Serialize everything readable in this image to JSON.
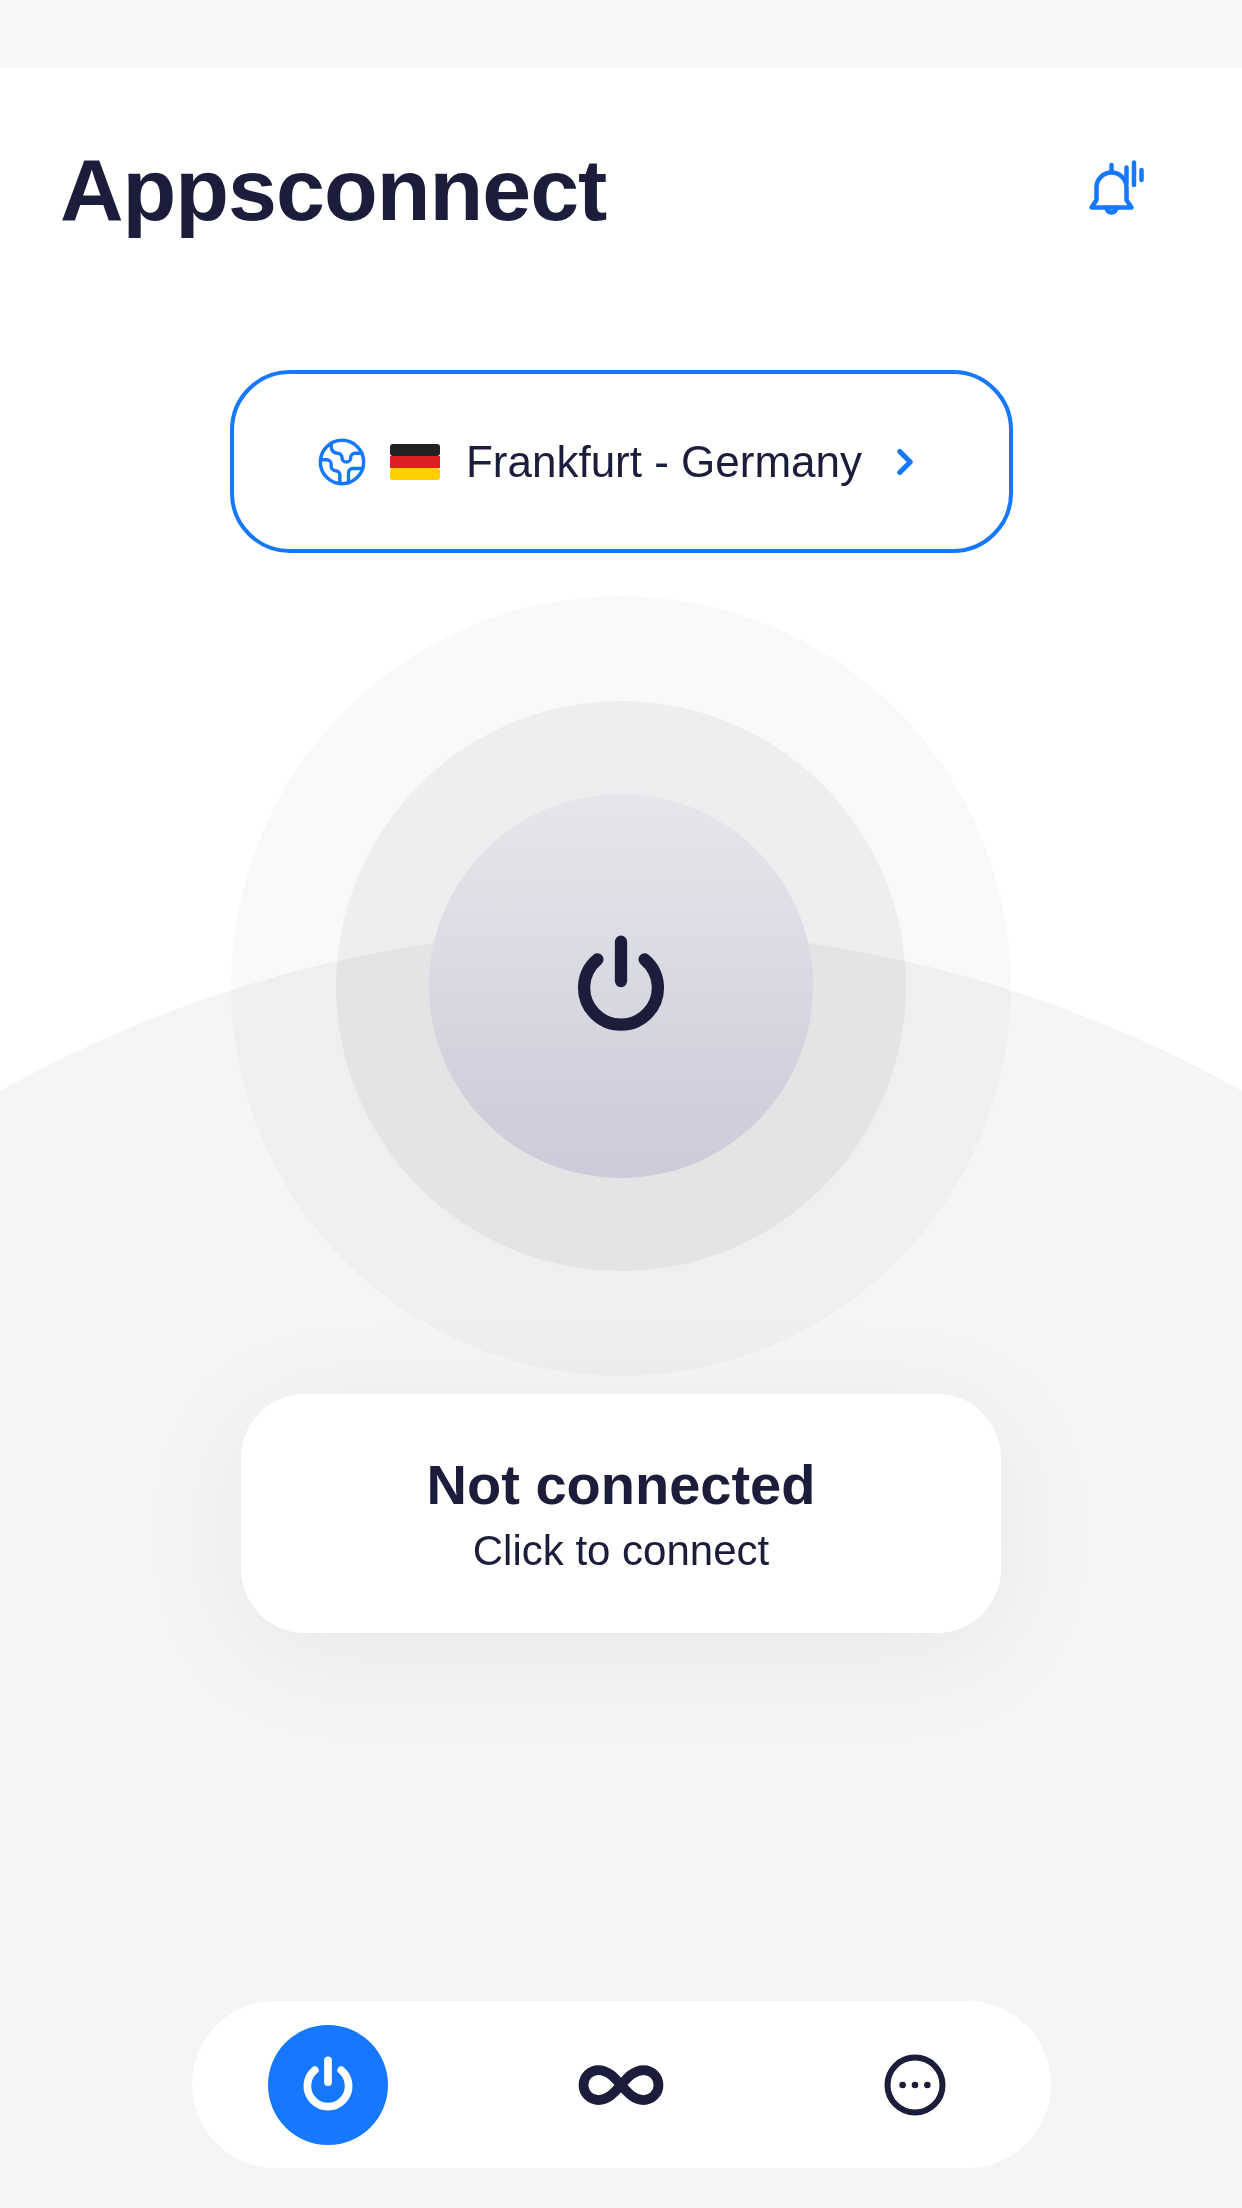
{
  "header": {
    "title": "Appsconnect"
  },
  "location": {
    "label": "Frankfurt - Germany"
  },
  "status": {
    "title": "Not connected",
    "subtitle": "Click to connect"
  },
  "nav": [
    {
      "kind": "power",
      "selected": true
    },
    {
      "kind": "infinity",
      "selected": false
    },
    {
      "kind": "more",
      "selected": false
    }
  ]
}
